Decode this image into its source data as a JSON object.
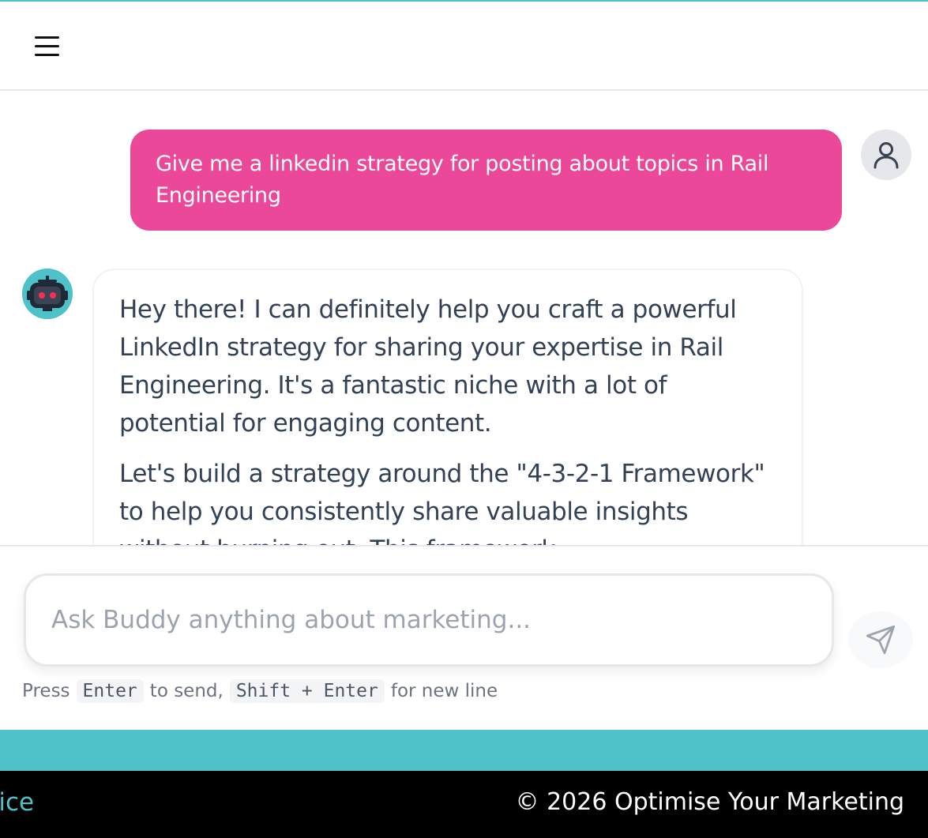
{
  "header": {
    "menu_icon": "hamburger-menu-icon"
  },
  "chat": {
    "user_message": "Give me a linkedin strategy for posting about topics in Rail Engineering",
    "user_avatar_icon": "user-icon",
    "bot_avatar_icon": "robot-icon",
    "bot_message_paragraphs": [
      "Hey there! I can definitely help you craft a powerful LinkedIn strategy for sharing your expertise in Rail Engineering. It's a fantastic niche with a lot of potential for engaging content.",
      "Let's build a strategy around the \"4-3-2-1 Framework\" to help you consistently share valuable insights without burning out. This framework"
    ]
  },
  "composer": {
    "placeholder": "Ask Buddy anything about marketing...",
    "send_icon": "send-icon",
    "hint_press": "Press",
    "hint_key_send": "Enter",
    "hint_to_send": "to send,",
    "hint_key_newline": "Shift + Enter",
    "hint_for_newline": "for new line"
  },
  "footer": {
    "link_fragment": "vice",
    "copyright": "© 2026 Optimise Your Marketing"
  },
  "colors": {
    "accent_teal": "#4fc1c9",
    "user_bubble_pink": "#ec4899",
    "footer_black": "#000000"
  }
}
